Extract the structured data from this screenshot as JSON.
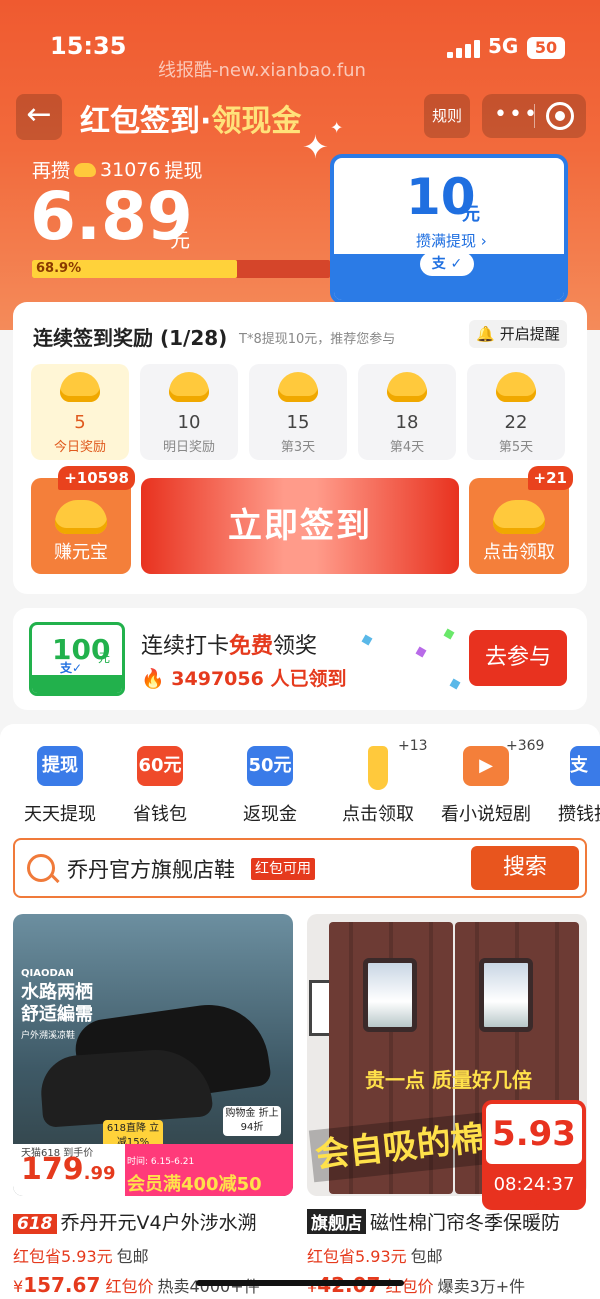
{
  "status_bar": {
    "time": "15:35",
    "network": "5G",
    "battery": "50"
  },
  "watermark": "线报酷-new.xianbao.fun",
  "header": {
    "title_part1": "红包签到·",
    "title_part2": "领现金",
    "rules_label": "规则",
    "back_icon": "back-arrow-icon",
    "colors": {
      "accent": "#ef5a30",
      "highlight": "#ffe27a"
    }
  },
  "wallet": {
    "save_prefix": "再攒",
    "save_amount": "31076",
    "save_suffix": "提现",
    "balance": "6.89",
    "balance_unit": "元",
    "progress_label": "68.9%",
    "progress_value": 0.689
  },
  "goal_card": {
    "amount": "10",
    "unit": "元",
    "subtitle": "攒满提现 ›",
    "pay_label": "支"
  },
  "checkin": {
    "title": "连续签到奖励 (1/28)",
    "note": "T*8提现10元，推荐您参与",
    "remind_label": "开启提醒",
    "days": [
      {
        "amount": "5",
        "label": "今日奖励"
      },
      {
        "amount": "10",
        "label": "明日奖励"
      },
      {
        "amount": "15",
        "label": "第3天"
      },
      {
        "amount": "18",
        "label": "第4天"
      },
      {
        "amount": "22",
        "label": "第5天"
      }
    ],
    "left_tile": {
      "label": "赚元宝",
      "badge": "+10598"
    },
    "signin_button": "立即签到",
    "right_tile": {
      "label": "点击领取",
      "badge": "+21"
    }
  },
  "promo": {
    "coupon_amount": "100",
    "coupon_unit": "元",
    "coupon_pay": "支",
    "title_a": "连续打卡",
    "title_b": "免费",
    "title_c": "领奖",
    "count": "3497056 人已领到",
    "join_label": "去参与"
  },
  "quick_actions": [
    {
      "icon_text": "提现",
      "label": "天天提现",
      "color": "#3a7be8"
    },
    {
      "icon_text": "60元",
      "label": "省钱包",
      "color": "#ef4a2a"
    },
    {
      "icon_text": "50元",
      "label": "返现金",
      "color": "#3a7be8"
    },
    {
      "icon_text": "",
      "label": "点击领取",
      "plus": "+13",
      "color": "#ffc93c"
    },
    {
      "icon_text": "▶",
      "label": "看小说短剧",
      "plus": "+369",
      "color": "#f47f3a"
    },
    {
      "icon_text": "支",
      "label": "攒钱拔",
      "color": "#3a7be8"
    }
  ],
  "search": {
    "query": "乔丹官方旗舰店鞋",
    "tag": "红包可用",
    "button": "搜索"
  },
  "products": [
    {
      "brand": "QIAODAN",
      "slogan": "水路两栖 舒适編需",
      "slogan_sub": "户外溯溪凉鞋",
      "promo_drop": "618直降 立减15%",
      "coupon": "购物金 折上94折",
      "store_tag": "天猫618 到手价",
      "image_price": "179",
      "image_price_decimal": ".99",
      "time": "时间: 6.15-6.21",
      "member_promo": "会员满400减50",
      "tag": "618",
      "name": "乔丹开元V4户外涉水溯",
      "saving": "红包省5.93元",
      "shipping": "包邮",
      "price_prefix": "¥",
      "price": "157.67",
      "price_suffix": "红包价",
      "sold": "热卖4000+件"
    },
    {
      "overlay_text": "贵一点 质量好几倍",
      "big_text": "会自吸的棉",
      "tag": "旗舰店",
      "name": "磁性棉门帘冬季保暖防",
      "saving": "红包省5.93元",
      "shipping": "包邮",
      "price_prefix": "¥",
      "price": "42.07",
      "price_suffix": "红包价",
      "sold": "爆卖3万+件"
    }
  ],
  "float_badge": {
    "amount": "5.93",
    "unit": "元",
    "countdown": "08:24:37"
  }
}
